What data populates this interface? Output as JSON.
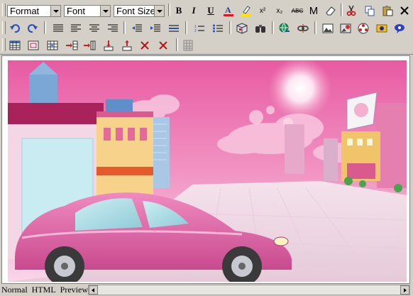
{
  "toolbar": {
    "format_select": "Format",
    "font_select": "Font",
    "font_size_select": "Font Size",
    "bold_label": "B",
    "italic_label": "I",
    "underline_label": "U",
    "font_color_label": "A",
    "superscript_label": "x²",
    "subscript_label": "x₂",
    "strikethrough_label": "ABC",
    "m_label": "M"
  },
  "colors": {
    "toolbar_bg": "#d4d0c8",
    "sky_pink": "#e65aa2",
    "car_pink": "#e06aa8"
  },
  "editor": {
    "image_description": "cartoon pink car on a pink city street"
  },
  "status_tabs": {
    "normal": "Normal",
    "html": "HTML",
    "preview": "Preview"
  }
}
